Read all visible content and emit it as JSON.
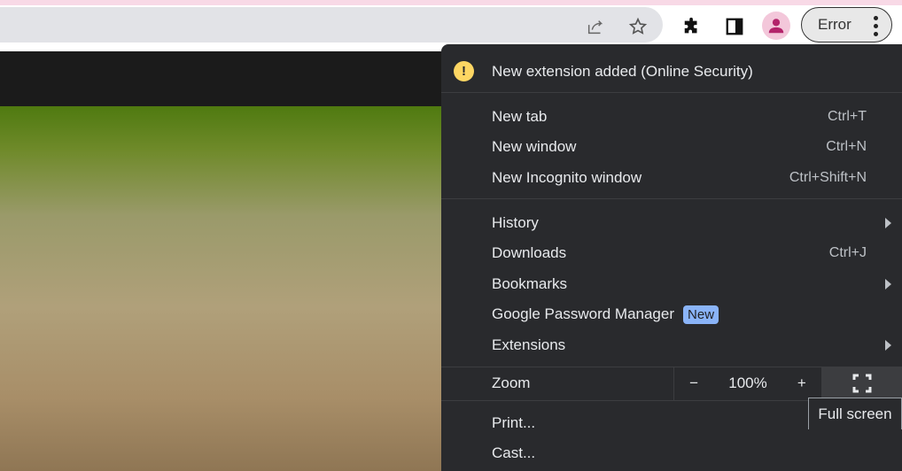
{
  "toolbar": {
    "profile_button_label": "Error"
  },
  "menu": {
    "notification": "New extension added (Online Security)",
    "items": [
      {
        "label": "New tab",
        "shortcut": "Ctrl+T"
      },
      {
        "label": "New window",
        "shortcut": "Ctrl+N"
      },
      {
        "label": "New Incognito window",
        "shortcut": "Ctrl+Shift+N"
      },
      {
        "label": "History"
      },
      {
        "label": "Downloads",
        "shortcut": "Ctrl+J"
      },
      {
        "label": "Bookmarks"
      },
      {
        "label": "Google Password Manager",
        "badge": "New"
      },
      {
        "label": "Extensions"
      },
      {
        "label": "Print..."
      },
      {
        "label": "Cast..."
      }
    ],
    "zoom": {
      "label": "Zoom",
      "minus": "−",
      "value": "100%",
      "plus": "+"
    }
  },
  "tooltip": "Full screen"
}
